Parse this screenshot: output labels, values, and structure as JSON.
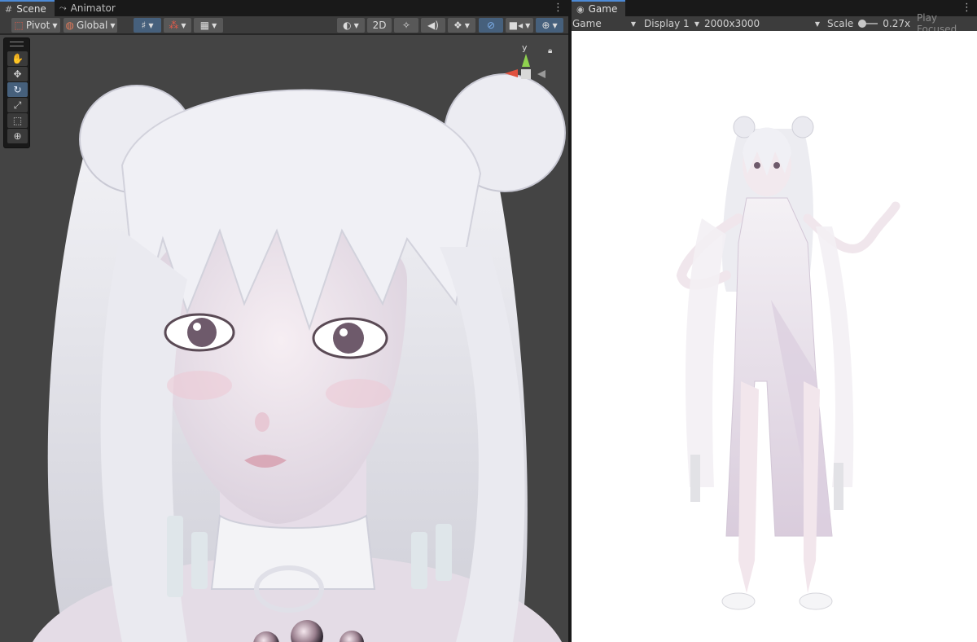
{
  "scene_tabs": [
    {
      "label": "Scene",
      "icon": "grid-icon",
      "active": true
    },
    {
      "label": "Animator",
      "icon": "animator-icon",
      "active": false
    }
  ],
  "scene_toolbar": {
    "pivot_label": "Pivot",
    "global_label": "Global",
    "twod_label": "2D"
  },
  "tools": [
    "hand-tool",
    "move-tool",
    "rotate-tool",
    "scale-tool",
    "rect-tool",
    "transform-tool"
  ],
  "gizmo": {
    "axis_label": "y"
  },
  "game_tab": {
    "label": "Game",
    "icon": "gamepad-icon"
  },
  "game_toolbar": {
    "mode": "Game",
    "display": "Display 1",
    "resolution": "2000x3000",
    "scale_label": "Scale",
    "scale_value": "0.27x",
    "scale_fraction": 0.05,
    "play_focused": "Play Focused"
  },
  "colors": {
    "accent": "#4c8ad6",
    "viewport_bg": "#444444",
    "game_bg": "#ffffff"
  }
}
